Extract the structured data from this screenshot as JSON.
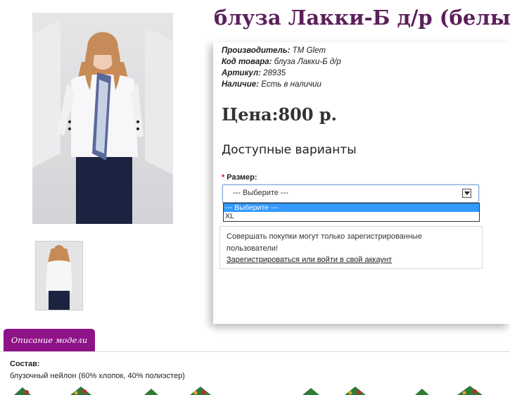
{
  "product": {
    "title": "блуза Лакки-Б д/р (белый)",
    "price": "Цена:800 р.",
    "specs": [
      {
        "label": "Производитель:",
        "value": "ТМ Glem"
      },
      {
        "label": "Код товара:",
        "value": "блуза Лакки-Б д/р"
      },
      {
        "label": "Артикул:",
        "value": "28935"
      },
      {
        "label": "Наличие:",
        "value": "Есть в наличии"
      }
    ]
  },
  "options": {
    "title": "Доступные варианты",
    "required_mark": "*",
    "size_label": "Размер:",
    "selected": "--- Выберите ---",
    "choices": [
      "--- Выберите ---",
      "XL"
    ]
  },
  "notice": {
    "message": "Совершать покупки могут только зарегистрированные пользователи!",
    "link": "Зарегистрироваться или войти в свой аккаунт"
  },
  "tabs": {
    "description_label": "Описание модели"
  },
  "description": {
    "heading": "Состав:",
    "text": "блузочный нейлон (60% хлопок, 40% полиэстер)"
  },
  "colors": {
    "title": "#5b1f5a",
    "tab": "#8e1388",
    "selected_option": "#3399ff"
  }
}
